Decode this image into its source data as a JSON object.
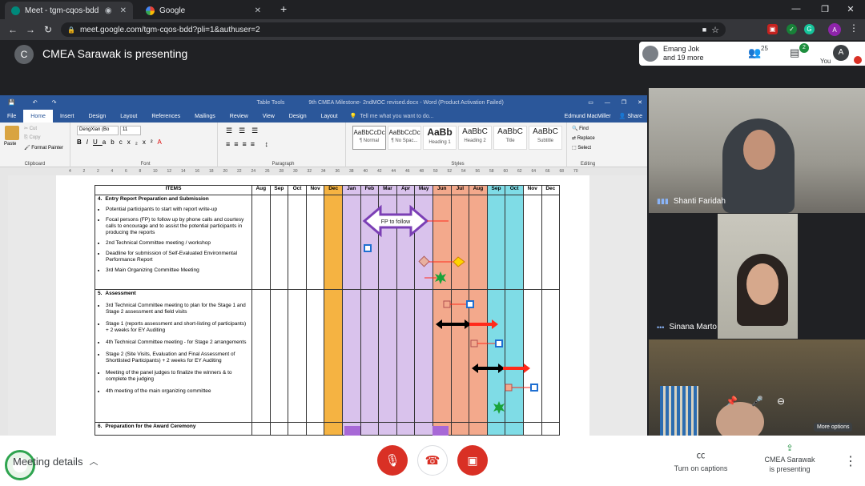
{
  "browser": {
    "tabs": [
      {
        "title": "Meet - tgm-cqos-bdd",
        "icon": "meet-icon"
      },
      {
        "title": "Google",
        "icon": "google-icon"
      }
    ],
    "new_tab": "+",
    "url": "meet.google.com/tgm-cqos-bdd?pli=1&authuser=2",
    "profile_initial": "A"
  },
  "meet": {
    "presenter_initial": "C",
    "presenting_title": "CMEA Sarawak is presenting",
    "participants_line1": "Emang Jok",
    "participants_line2": "and 19 more",
    "people_count": "25",
    "chat_badge": "2",
    "you_label": "You",
    "you_initial": "A"
  },
  "word": {
    "title": "9th CMEA Milestone- 2ndMOC revised.docx - Word (Product Activation Failed)",
    "table_tools": "Table Tools",
    "user": "Edmund MacMiller",
    "tabs": [
      "File",
      "Home",
      "Insert",
      "Design",
      "Layout",
      "References",
      "Mailings",
      "Review",
      "View",
      "Design",
      "Layout"
    ],
    "tell_me": "Tell me what you want to do...",
    "share": "Share",
    "clipboard": {
      "paste": "Paste",
      "cut": "Cut",
      "copy": "Copy",
      "format_painter": "Format Painter",
      "label": "Clipboard"
    },
    "font": {
      "name": "DengXian (Bo",
      "size": "11",
      "label": "Font"
    },
    "paragraph_label": "Paragraph",
    "styles": [
      {
        "preview": "AaBbCcDc",
        "name": "¶ Normal"
      },
      {
        "preview": "AaBbCcDc",
        "name": "¶ No Spac..."
      },
      {
        "preview": "AaBb",
        "name": "Heading 1"
      },
      {
        "preview": "AaBbC",
        "name": "Heading 2"
      },
      {
        "preview": "AaBbC",
        "name": "Title"
      },
      {
        "preview": "AaBbC",
        "name": "Subtitle"
      }
    ],
    "styles_label": "Styles",
    "editing": {
      "find": "Find",
      "replace": "Replace",
      "select": "Select",
      "label": "Editing"
    },
    "ruler_numbers": [
      "4",
      "2",
      "2",
      "4",
      "6",
      "8",
      "10",
      "12",
      "14",
      "16",
      "18",
      "20",
      "22",
      "24",
      "26",
      "28",
      "30",
      "32",
      "34",
      "36",
      "38",
      "40",
      "42",
      "44",
      "46",
      "48",
      "50",
      "52",
      "54",
      "56",
      "58",
      "60",
      "62",
      "64",
      "66",
      "68",
      "70"
    ]
  },
  "table": {
    "headers": [
      "ITEMS",
      "Aug",
      "Sep",
      "Oct",
      "Nov",
      "Dec",
      "Jan",
      "Feb",
      "Mar",
      "Apr",
      "May",
      "Jun",
      "Jul",
      "Aug",
      "Sep",
      "Oct",
      "Nov",
      "Dec"
    ],
    "month_colors": [
      "#ffffff",
      "#ffffff",
      "#ffffff",
      "#ffffff",
      "#ffffff",
      "#f5b342",
      "#d9c2ec",
      "#d9c2ec",
      "#d9c2ec",
      "#d9c2ec",
      "#d9c2ec",
      "#f3a98c",
      "#f3a98c",
      "#f3a98c",
      "#7fdce6",
      "#7fdce6",
      "#ffffff"
    ],
    "sections": [
      {
        "num": "4.",
        "title": "Entry Report Preparation and Submission",
        "items": [
          "Potential participants to start with report write-up",
          "Focal persons (FP) to follow up by phone calls and courtesy calls to encourage and to assist the potential participants in producing the reports",
          "2nd Technical Committee meeting / workshop",
          "Deadline for submission of Self-Evaluated Environmental Performance Report",
          "3rd Main Organizing Committee Meeting"
        ]
      },
      {
        "num": "5.",
        "title": "Assessment",
        "items": [
          "3rd Technical Committee meeting to plan for the Stage 1 and Stage 2 assessment and field visits",
          "Stage 1 (reports assessment and short-listing of participants) + 2 weeks for EY Auditing",
          "4th Technical Committee meeting - for Stage 2 arrangements",
          "Stage 2 (Site Visits, Evaluation and Final Assessment of Shortlisted Participants) + 2 weeks for EY Auditing",
          "Meeting of the panel judges to finalize the winners & to complete the judging",
          "4th meeting of the main organizing committee"
        ]
      },
      {
        "num": "6.",
        "title": "Preparation for the Award Ceremony",
        "items": []
      }
    ],
    "fp_arrow_label": "FP to follow"
  },
  "participants": [
    {
      "name": "Shanti Faridah"
    },
    {
      "name": "Sinana Marto"
    },
    {
      "name": "",
      "more_options": "More options"
    }
  ],
  "bottom": {
    "meeting_details": "Meeting details",
    "captions": "Turn on captions",
    "presenting_line1": "CMEA Sarawak",
    "presenting_line2": "is presenting"
  },
  "colors": {
    "meet_dark": "#202124",
    "word_blue": "#2b579a",
    "end_call_red": "#d93025",
    "arrow_red": "#ff2a1a",
    "marker_blue": "#1f6fd1",
    "star_green": "#1aa33a"
  }
}
